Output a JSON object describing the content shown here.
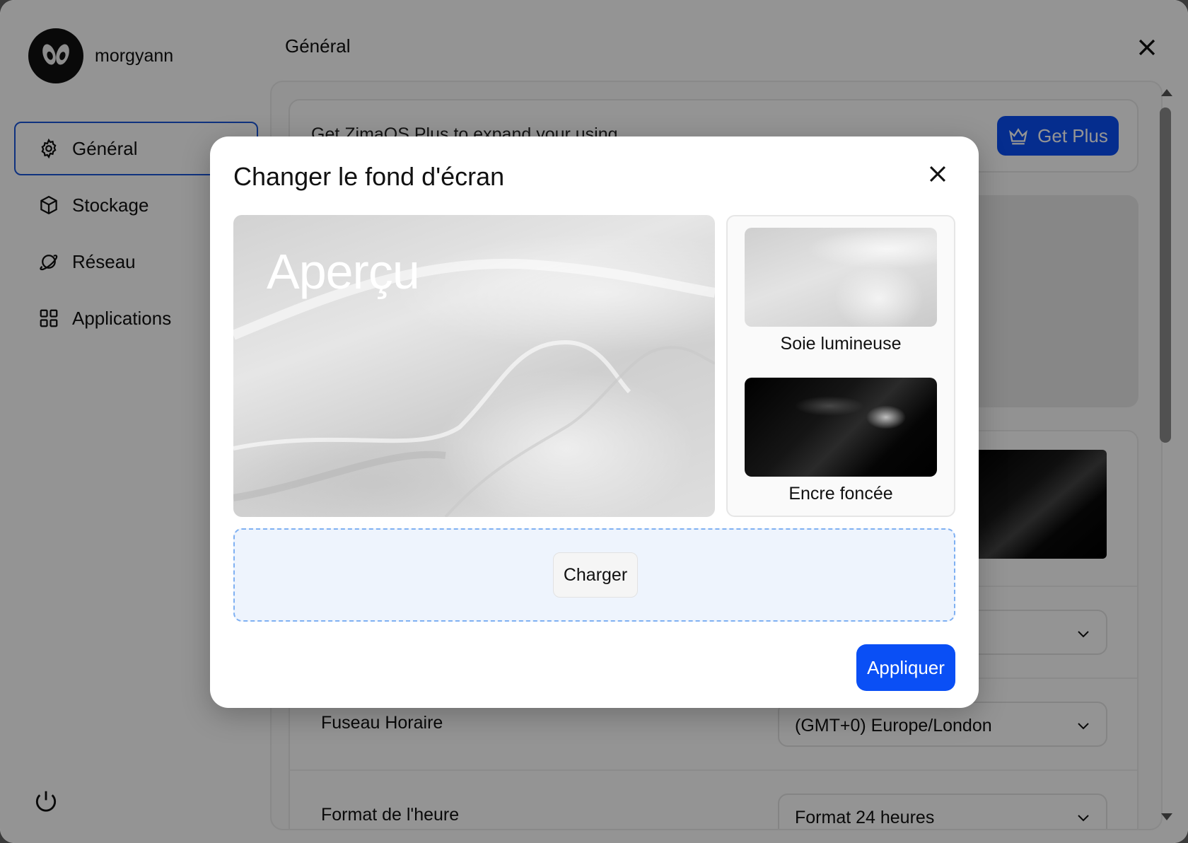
{
  "user": {
    "name": "morgyann"
  },
  "sidebar": {
    "items": [
      {
        "label": "Général",
        "icon": "gear-icon",
        "active": true
      },
      {
        "label": "Stockage",
        "icon": "box-icon"
      },
      {
        "label": "Réseau",
        "icon": "planet-icon"
      },
      {
        "label": "Applications",
        "icon": "grid-icon"
      }
    ],
    "power_icon": "power-icon"
  },
  "header": {
    "title": "Général"
  },
  "promo": {
    "text": "Get ZimaOS Plus to expand your using",
    "button_label": "Get Plus",
    "button_icon": "crown-icon"
  },
  "settings": {
    "timezone": {
      "label": "Fuseau Horaire",
      "value": "(GMT+0) Europe/London"
    },
    "time_format": {
      "label": "Format de l'heure",
      "value": "Format 24 heures"
    }
  },
  "modal": {
    "title": "Changer le fond d'écran",
    "preview_label": "Aperçu",
    "wallpapers": [
      {
        "label": "Soie lumineuse"
      },
      {
        "label": "Encre foncée"
      }
    ],
    "upload_label": "Charger",
    "apply_label": "Appliquer"
  },
  "colors": {
    "accent": "#0a4ff5",
    "active_border": "#1a56db",
    "dropzone_border": "#7fb0f2"
  }
}
